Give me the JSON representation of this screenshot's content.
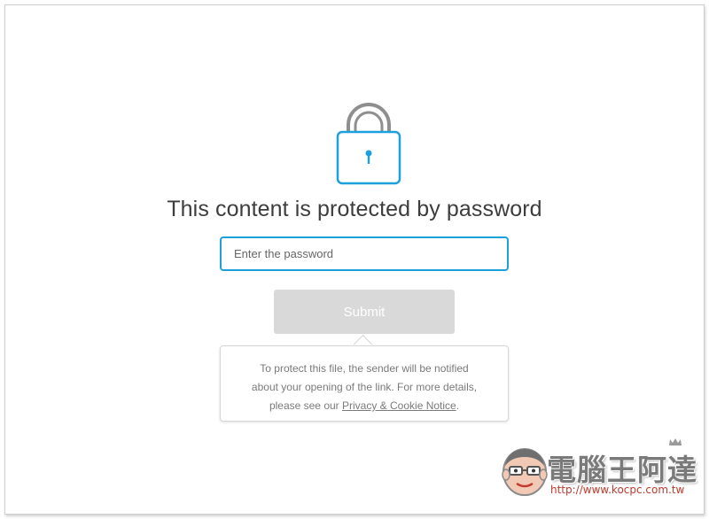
{
  "page": {
    "title": "This content is protected by password"
  },
  "password": {
    "placeholder": "Enter the password",
    "value": ""
  },
  "submit": {
    "label": "Submit"
  },
  "notice": {
    "line1": "To protect this file, the sender will be notified",
    "line2": "about your opening of the link. For more details,",
    "line3_prefix": "please see our ",
    "link_label": "Privacy & Cookie Notice",
    "line3_suffix": "."
  },
  "watermark": {
    "title": "電腦王阿達",
    "url": "http://www.kocpc.com.tw"
  },
  "icons": {
    "lock": "lock-icon"
  },
  "colors": {
    "accent": "#1da1dd",
    "button_disabled": "#d9d9d9",
    "shackle": "#8f8f8f"
  }
}
